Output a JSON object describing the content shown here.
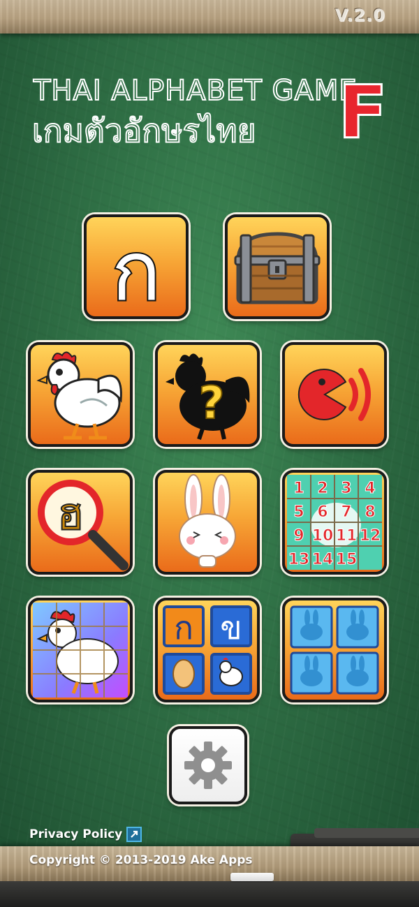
{
  "version": "V.2.0",
  "title": {
    "english": "THAI ALPHABET GAME",
    "thai": "เกมตัวอักษรไทย",
    "badge": "F"
  },
  "tiles": {
    "alphabet": {
      "glyph": "ก"
    },
    "treasure": {
      "icon": "treasure-chest-icon"
    },
    "animal": {
      "icon": "chicken-icon"
    },
    "guess": {
      "icon": "chicken-silhouette-question-icon",
      "mark": "?"
    },
    "sound": {
      "icon": "sound-pacman-icon"
    },
    "find": {
      "glyph": "ฮ",
      "icon": "magnifier-icon"
    },
    "rabbit": {
      "icon": "rabbit-icon"
    },
    "slide_puzzle": {
      "numbers": [
        "1",
        "2",
        "3",
        "4",
        "5",
        "6",
        "7",
        "8",
        "9",
        "10",
        "11",
        "12",
        "13",
        "14",
        "15"
      ]
    },
    "jigsaw": {
      "icon": "chicken-jigsaw-icon"
    },
    "match": {
      "glyphs": [
        "ก",
        "ข"
      ]
    },
    "memory": {
      "icon": "memory-cards-icon"
    },
    "settings": {
      "icon": "gear-icon"
    }
  },
  "footer": {
    "privacy": "Privacy Policy",
    "copyright": "Copyright © 2013-2019 Ake Apps"
  },
  "colors": {
    "board": "#2f6f45",
    "tile_top": "#ffd45a",
    "tile_bottom": "#ea6b1a",
    "accent_red": "#e8262e"
  }
}
